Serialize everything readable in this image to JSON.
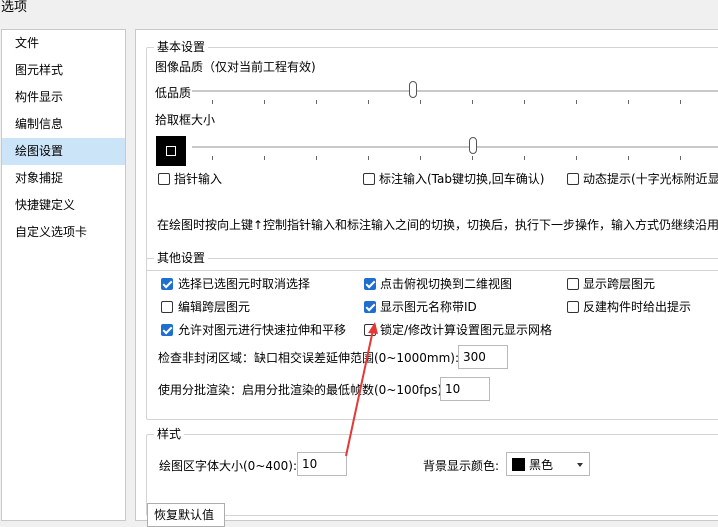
{
  "window": {
    "title": "选项"
  },
  "sidebar": {
    "items": [
      {
        "label": "文件"
      },
      {
        "label": "图元样式"
      },
      {
        "label": "构件显示"
      },
      {
        "label": "编制信息"
      },
      {
        "label": "绘图设置",
        "selected": true
      },
      {
        "label": "对象捕捉"
      },
      {
        "label": "快捷键定义"
      },
      {
        "label": "自定义选项卡"
      }
    ]
  },
  "basic": {
    "title": "基本设置",
    "image_quality_label": "图像品质（仅对当前工程有效)",
    "low_quality_label": "低品质",
    "image_quality_level": 0.41,
    "pick_box_label": "拾取框大小",
    "pick_box_level": 0.52,
    "pointer_input": {
      "label": "指针输入",
      "checked": false
    },
    "dimension_input": {
      "label": "标注输入(Tab键切换,回车确认)",
      "checked": false
    },
    "dynamic_hint": {
      "label": "动态提示(十字光标附近显",
      "checked": false
    },
    "note": "在绘图时按向上键↑控制指针输入和标注输入之间的切换，切换后，执行下一步操作，输入方式仍继续沿用"
  },
  "other": {
    "title": "其他设置",
    "checkboxes": [
      {
        "label": "选择已选图元时取消选择",
        "checked": true
      },
      {
        "label": "点击俯视切换到二维视图",
        "checked": true
      },
      {
        "label": "显示跨层图元",
        "checked": false
      },
      {
        "label": "编辑跨层图元",
        "checked": false
      },
      {
        "label": "显示图元名称带ID",
        "checked": true
      },
      {
        "label": "反建构件时给出提示",
        "checked": false
      },
      {
        "label": "允许对图元进行快速拉伸和平移",
        "checked": true
      },
      {
        "label": "锁定/修改计算设置图元显示网格",
        "checked": false
      }
    ],
    "check_open_label": "检查非封闭区域：缺口相交误差延伸范围(0~1000mm):",
    "check_open_value": "300",
    "batch_render_label": "使用分批渲染：启用分批渲染的最低帧数(0~100fps):",
    "batch_render_value": "10"
  },
  "style": {
    "title": "样式",
    "font_size_label": "绘图区字体大小(0~400):",
    "font_size_value": "10",
    "bg_color_label": "背景显示颜色:",
    "bg_color_value": "黑色",
    "bg_color_hex": "#000000"
  },
  "buttons": {
    "restore_default": "恢复默认值"
  },
  "annotation": {
    "arrow_color": "#e53935"
  }
}
